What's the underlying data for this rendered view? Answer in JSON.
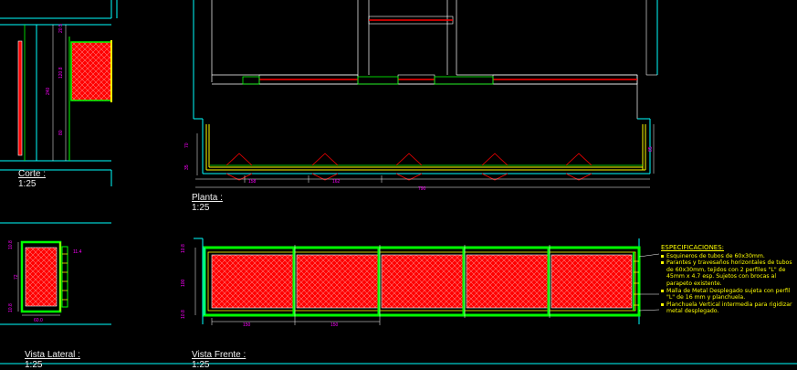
{
  "views": {
    "corte": {
      "title": "Corte :",
      "scale": "1:25"
    },
    "planta": {
      "title": "Planta :",
      "scale": "1:25"
    },
    "lateral": {
      "title": "Vista Lateral :",
      "scale": "1:25"
    },
    "frente": {
      "title": "Vista Frente :",
      "scale": "1:25"
    }
  },
  "dims": {
    "corte_top": "20.5",
    "corte_mid": "120.8",
    "corte_total": "240",
    "corte_low": "80",
    "planta_left_70": "70",
    "planta_left_35": "35",
    "planta_right": "85",
    "planta_span_a": "158",
    "planta_span_b": "162",
    "planta_total": "790",
    "lateral_top": "10.8",
    "lateral_mid": "72",
    "lateral_bot": "10.8",
    "lateral_width": "60.0",
    "lateral_side": "11.4",
    "frente_top": "10.8",
    "frente_mid": "100",
    "frente_bot": "10.8",
    "frente_span_a": "150",
    "frente_span_b": "150"
  },
  "specs": {
    "heading": "ESPECIFICACIONES:",
    "items": [
      "Esquineros de tubos de 60x30mm.",
      "Parantes y travesaños horizontales de tubos de 60x30mm, tejidos con 2 perfiles \"L\" de 45mm x 4.7 esp. Sujetos con brocas al parapeto existente.",
      "Malla de Metal Desplegado sujeta con perfil \"L\" de 16 mm y planchuela.",
      "Planchuela Vertical intermedia para rigidizar metal desplegado."
    ]
  },
  "colors": {
    "wall": "#00ffff",
    "frame": "#00ff00",
    "infill": "#ff0000",
    "dimension": "#ff00ff",
    "annotation": "#ffff00",
    "line": "#ffffff",
    "background": "#000000"
  }
}
